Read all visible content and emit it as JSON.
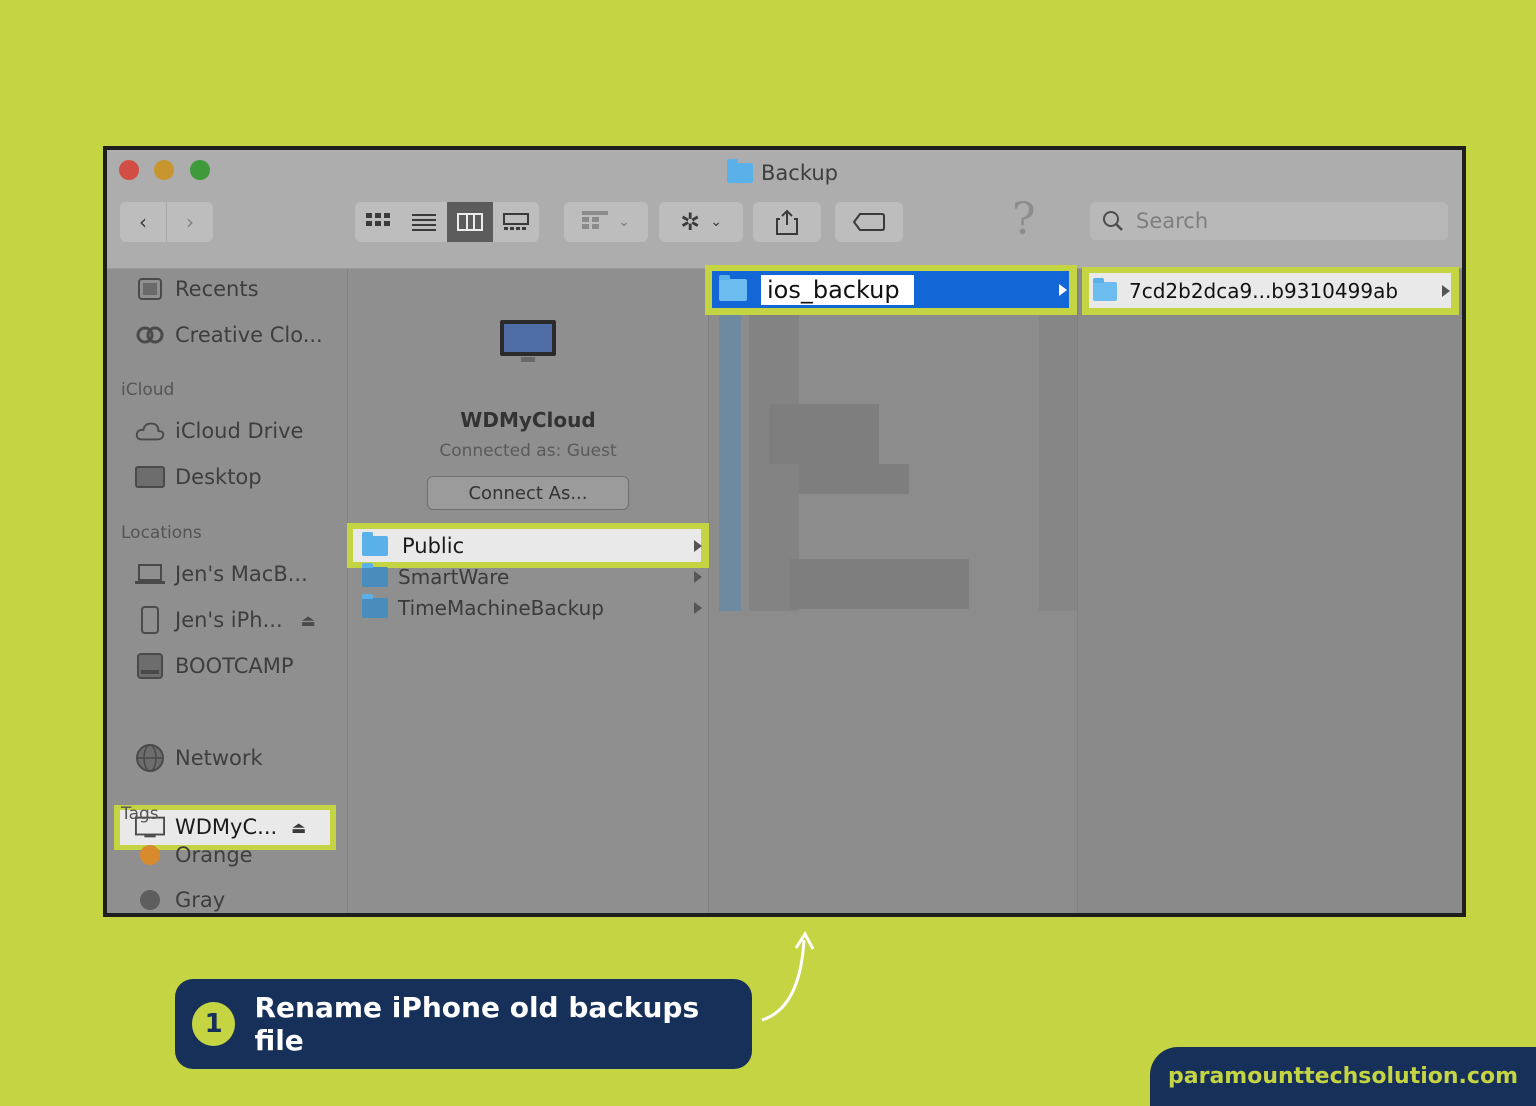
{
  "window": {
    "title": "Backup",
    "toolbar": {
      "nav": [
        "back-icon",
        "forward-icon"
      ],
      "view_modes": [
        "icon-view-icon",
        "list-view-icon",
        "column-view-icon",
        "gallery-view-icon"
      ],
      "active_view": "column",
      "help_glyph": "?"
    },
    "search": {
      "placeholder": "Search"
    }
  },
  "sidebar": {
    "sections": [
      {
        "heading": "",
        "items": [
          {
            "label": "Recents",
            "icon": "recents-icon"
          },
          {
            "label": "Creative Clo...",
            "icon": "creative-cloud-icon"
          }
        ]
      },
      {
        "heading": "iCloud",
        "items": [
          {
            "label": "iCloud Drive",
            "icon": "cloud-icon"
          },
          {
            "label": "Desktop",
            "icon": "desktop-folder-icon"
          }
        ]
      },
      {
        "heading": "Locations",
        "items": [
          {
            "label": "Jen's MacB...",
            "icon": "laptop-icon"
          },
          {
            "label": "Jen's iPh...",
            "icon": "iphone-icon"
          },
          {
            "label": "BOOTCAMP",
            "icon": "disk-icon"
          },
          {
            "label": "WDMyC...",
            "icon": "display-icon",
            "selected": true
          },
          {
            "label": "Network",
            "icon": "network-icon"
          }
        ]
      },
      {
        "heading": "Tags",
        "items": [
          {
            "label": "Orange",
            "color": "#d98a2c"
          },
          {
            "label": "Gray",
            "color": "#5e5e5e"
          }
        ]
      }
    ]
  },
  "server": {
    "name": "WDMyCloud",
    "status": "Connected as: Guest",
    "connect_button": "Connect As..."
  },
  "column1": {
    "folders": [
      {
        "label": "Public",
        "selected": true
      },
      {
        "label": "SmartWare"
      },
      {
        "label": "TimeMachineBackup"
      }
    ]
  },
  "column2": {
    "editing_folder": "ios_backup"
  },
  "column3": {
    "folder": "7cd2b2dca9...b9310499ab"
  },
  "callout": {
    "number": "1",
    "text": "Rename iPhone old backups file"
  },
  "brand": "paramounttechsolution.com",
  "colors": {
    "accent": "#c5d443",
    "navy": "#17305a",
    "selection_blue": "#1266d6"
  }
}
